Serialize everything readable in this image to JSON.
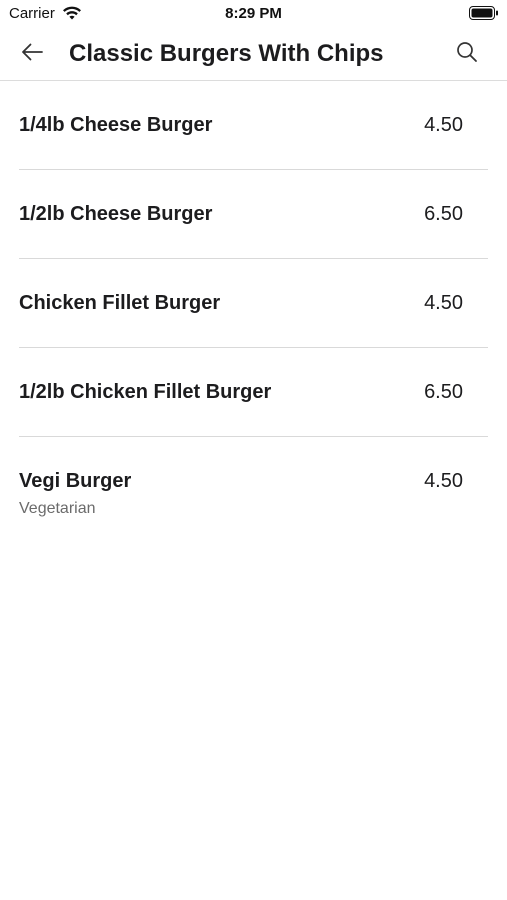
{
  "status_bar": {
    "carrier": "Carrier",
    "time": "8:29 PM"
  },
  "nav": {
    "title": "Classic Burgers With Chips",
    "back_icon": "arrow-left-icon",
    "search_icon": "search-icon"
  },
  "menu": {
    "items": [
      {
        "name": "1/4lb Cheese Burger",
        "price": "4.50"
      },
      {
        "name": "1/2lb Cheese Burger",
        "price": "6.50"
      },
      {
        "name": "Chicken Fillet Burger",
        "price": "4.50"
      },
      {
        "name": "1/2lb Chicken Fillet Burger",
        "price": "6.50"
      },
      {
        "name": "Vegi Burger",
        "price": "4.50",
        "tag": "Vegetarian"
      }
    ]
  }
}
